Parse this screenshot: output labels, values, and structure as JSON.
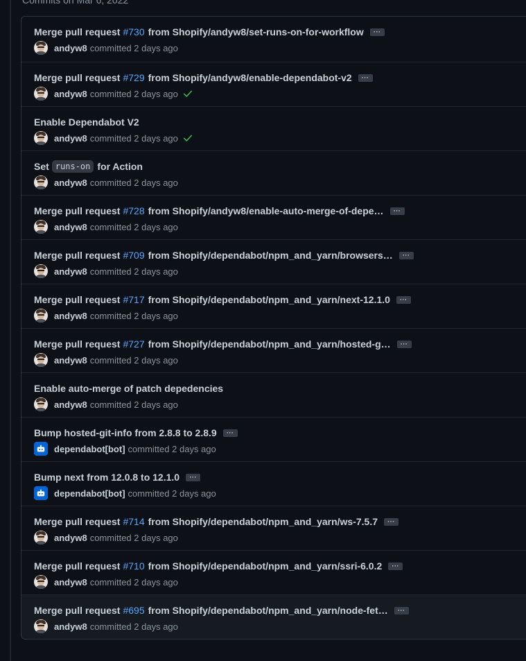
{
  "group_heading": "Commits on Mar 6, 2022",
  "commits": [
    {
      "title_prefix": "Merge pull request",
      "pr": "#730",
      "title_suffix": "from Shopify/andyw8/set-runs-on-for-workflow",
      "author": "andyw8",
      "committed": "committed",
      "time": "2 days ago",
      "ellipsis": "···",
      "status": "",
      "bot": false
    },
    {
      "title_prefix": "Merge pull request",
      "pr": "#729",
      "title_suffix": "from Shopify/andyw8/enable-dependabot-v2",
      "author": "andyw8",
      "committed": "committed",
      "time": "2 days ago",
      "ellipsis": "···",
      "status": "success",
      "bot": false
    },
    {
      "title_prefix": "Enable Dependabot V2",
      "pr": "",
      "title_suffix": "",
      "author": "andyw8",
      "committed": "committed",
      "time": "2 days ago",
      "ellipsis": "",
      "status": "success",
      "bot": false
    },
    {
      "title_prefix": "Set",
      "code": "runs-on",
      "title_suffix": "for Action",
      "pr": "",
      "author": "andyw8",
      "committed": "committed",
      "time": "2 days ago",
      "ellipsis": "",
      "status": "",
      "bot": false
    },
    {
      "title_prefix": "Merge pull request",
      "pr": "#728",
      "title_suffix": "from Shopify/andyw8/enable-auto-merge-of-depe…",
      "author": "andyw8",
      "committed": "committed",
      "time": "2 days ago",
      "ellipsis": "···",
      "status": "",
      "bot": false
    },
    {
      "title_prefix": "Merge pull request",
      "pr": "#709",
      "title_suffix": "from Shopify/dependabot/npm_and_yarn/browsers…",
      "author": "andyw8",
      "committed": "committed",
      "time": "2 days ago",
      "ellipsis": "···",
      "status": "",
      "bot": false
    },
    {
      "title_prefix": "Merge pull request",
      "pr": "#717",
      "title_suffix": "from Shopify/dependabot/npm_and_yarn/next-12.1.0",
      "author": "andyw8",
      "committed": "committed",
      "time": "2 days ago",
      "ellipsis": "···",
      "status": "",
      "bot": false
    },
    {
      "title_prefix": "Merge pull request",
      "pr": "#727",
      "title_suffix": "from Shopify/dependabot/npm_and_yarn/hosted-g…",
      "author": "andyw8",
      "committed": "committed",
      "time": "2 days ago",
      "ellipsis": "···",
      "status": "",
      "bot": false
    },
    {
      "title_prefix": "Enable auto-merge of patch depedencies",
      "pr": "",
      "title_suffix": "",
      "author": "andyw8",
      "committed": "committed",
      "time": "2 days ago",
      "ellipsis": "",
      "status": "",
      "bot": false
    },
    {
      "title_prefix": "Bump hosted-git-info from 2.8.8 to 2.8.9",
      "pr": "",
      "title_suffix": "",
      "author": "dependabot[bot]",
      "committed": "committed",
      "time": "2 days ago",
      "ellipsis": "···",
      "status": "",
      "bot": true
    },
    {
      "title_prefix": "Bump next from 12.0.8 to 12.1.0",
      "pr": "",
      "title_suffix": "",
      "author": "dependabot[bot]",
      "committed": "committed",
      "time": "2 days ago",
      "ellipsis": "···",
      "status": "",
      "bot": true
    },
    {
      "title_prefix": "Merge pull request",
      "pr": "#714",
      "title_suffix": "from Shopify/dependabot/npm_and_yarn/ws-7.5.7",
      "author": "andyw8",
      "committed": "committed",
      "time": "2 days ago",
      "ellipsis": "···",
      "status": "",
      "bot": false
    },
    {
      "title_prefix": "Merge pull request",
      "pr": "#710",
      "title_suffix": "from Shopify/dependabot/npm_and_yarn/ssri-6.0.2",
      "author": "andyw8",
      "committed": "committed",
      "time": "2 days ago",
      "ellipsis": "···",
      "status": "",
      "bot": false
    },
    {
      "title_prefix": "Merge pull request",
      "pr": "#695",
      "title_suffix": "from Shopify/dependabot/npm_and_yarn/node-fet…",
      "author": "andyw8",
      "committed": "committed",
      "time": "2 days ago",
      "ellipsis": "···",
      "status": "",
      "bot": false
    }
  ],
  "colors": {
    "link": "#58a6ff",
    "success": "#3fb950",
    "bot_avatar": "#0366d6"
  },
  "icons": {
    "success": "check-icon",
    "bot": "dependabot-icon",
    "more": "ellipsis-icon"
  }
}
